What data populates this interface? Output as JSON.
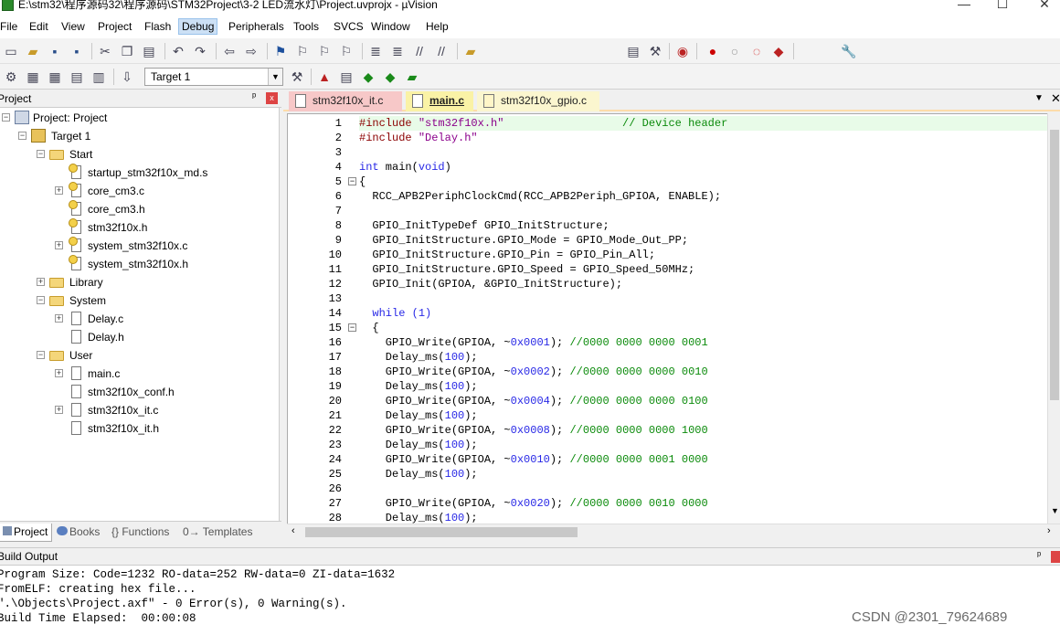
{
  "window": {
    "title": "E:\\stm32\\程序源码32\\程序源码\\STM32Project\\3-2 LED流水灯\\Project.uvprojx - µVision",
    "minimize": "—",
    "maximize": "☐",
    "close": "✕"
  },
  "menu": [
    "File",
    "Edit",
    "View",
    "Project",
    "Flash",
    "Debug",
    "Peripherals",
    "Tools",
    "SVCS",
    "Window",
    "Help"
  ],
  "toolbar": {
    "target_select": "Target 1"
  },
  "project_panel": {
    "title": "Project",
    "pin": "ᵖ",
    "close": "x",
    "tree": {
      "project": "Project: Project",
      "target": "Target 1",
      "groups": [
        {
          "name": "Start",
          "files": [
            "startup_stm32f10x_md.s",
            "core_cm3.c",
            "core_cm3.h",
            "stm32f10x.h",
            "system_stm32f10x.c",
            "system_stm32f10x.h"
          ]
        },
        {
          "name": "Library",
          "files": []
        },
        {
          "name": "System",
          "files": [
            "Delay.c",
            "Delay.h"
          ]
        },
        {
          "name": "User",
          "files": [
            "main.c",
            "stm32f10x_conf.h",
            "stm32f10x_it.c",
            "stm32f10x_it.h"
          ]
        }
      ]
    },
    "tabs": [
      "Project",
      "Books",
      "{} Functions",
      "0→ Templates"
    ]
  },
  "editor": {
    "tabs": [
      "stm32f10x_it.c",
      "main.c",
      "stm32f10x_gpio.c"
    ],
    "active_tab": "main.c",
    "highlighted_line": 1,
    "lines": [
      {
        "n": "1",
        "fold": ""
      },
      {
        "n": "2",
        "fold": ""
      },
      {
        "n": "3",
        "fold": ""
      },
      {
        "n": "4",
        "fold": ""
      },
      {
        "n": "5",
        "fold": "−"
      },
      {
        "n": "6",
        "fold": ""
      },
      {
        "n": "7",
        "fold": ""
      },
      {
        "n": "8",
        "fold": ""
      },
      {
        "n": "9",
        "fold": ""
      },
      {
        "n": "10",
        "fold": ""
      },
      {
        "n": "11",
        "fold": ""
      },
      {
        "n": "12",
        "fold": ""
      },
      {
        "n": "13",
        "fold": ""
      },
      {
        "n": "14",
        "fold": ""
      },
      {
        "n": "15",
        "fold": "−"
      },
      {
        "n": "16",
        "fold": ""
      },
      {
        "n": "17",
        "fold": ""
      },
      {
        "n": "18",
        "fold": ""
      },
      {
        "n": "19",
        "fold": ""
      },
      {
        "n": "20",
        "fold": ""
      },
      {
        "n": "21",
        "fold": ""
      },
      {
        "n": "22",
        "fold": ""
      },
      {
        "n": "23",
        "fold": ""
      },
      {
        "n": "24",
        "fold": ""
      },
      {
        "n": "25",
        "fold": ""
      },
      {
        "n": "26",
        "fold": ""
      },
      {
        "n": "27",
        "fold": ""
      },
      {
        "n": "28",
        "fold": ""
      }
    ],
    "code": [
      [
        {
          "t": "#include ",
          "c": "pp"
        },
        {
          "t": "\"stm32f10x.h\"",
          "c": "s"
        },
        {
          "t": "                  // Device header",
          "c": "c"
        }
      ],
      [
        {
          "t": "#include ",
          "c": "pp"
        },
        {
          "t": "\"Delay.h\"",
          "c": "s"
        }
      ],
      [],
      [
        {
          "t": "int",
          "c": "k"
        },
        {
          "t": " main(",
          "c": ""
        },
        {
          "t": "void",
          "c": "k"
        },
        {
          "t": ")",
          "c": ""
        }
      ],
      [
        {
          "t": "{",
          "c": ""
        }
      ],
      [
        {
          "t": "  RCC_APB2PeriphClockCmd(RCC_APB2Periph_GPIOA, ENABLE);",
          "c": ""
        }
      ],
      [],
      [
        {
          "t": "  GPIO_InitTypeDef GPIO_InitStructure;",
          "c": ""
        }
      ],
      [
        {
          "t": "  GPIO_InitStructure.GPIO_Mode = GPIO_Mode_Out_PP;",
          "c": ""
        }
      ],
      [
        {
          "t": "  GPIO_InitStructure.GPIO_Pin = GPIO_Pin_All;",
          "c": ""
        }
      ],
      [
        {
          "t": "  GPIO_InitStructure.GPIO_Speed = GPIO_Speed_50MHz;",
          "c": ""
        }
      ],
      [
        {
          "t": "  GPIO_Init(GPIOA, &GPIO_InitStructure);",
          "c": ""
        }
      ],
      [],
      [
        {
          "t": "  ",
          "c": ""
        },
        {
          "t": "while",
          "c": "k"
        },
        {
          "t": " (1)",
          "c": "n"
        }
      ],
      [
        {
          "t": "  {",
          "c": ""
        }
      ],
      [
        {
          "t": "    GPIO_Write(GPIOA, ~",
          "c": ""
        },
        {
          "t": "0x0001",
          "c": "n"
        },
        {
          "t": "); ",
          "c": ""
        },
        {
          "t": "//0000 0000 0000 0001",
          "c": "c"
        }
      ],
      [
        {
          "t": "    Delay_ms(",
          "c": ""
        },
        {
          "t": "100",
          "c": "n"
        },
        {
          "t": ");",
          "c": ""
        }
      ],
      [
        {
          "t": "    GPIO_Write(GPIOA, ~",
          "c": ""
        },
        {
          "t": "0x0002",
          "c": "n"
        },
        {
          "t": "); ",
          "c": ""
        },
        {
          "t": "//0000 0000 0000 0010",
          "c": "c"
        }
      ],
      [
        {
          "t": "    Delay_ms(",
          "c": ""
        },
        {
          "t": "100",
          "c": "n"
        },
        {
          "t": ");",
          "c": ""
        }
      ],
      [
        {
          "t": "    GPIO_Write(GPIOA, ~",
          "c": ""
        },
        {
          "t": "0x0004",
          "c": "n"
        },
        {
          "t": "); ",
          "c": ""
        },
        {
          "t": "//0000 0000 0000 0100",
          "c": "c"
        }
      ],
      [
        {
          "t": "    Delay_ms(",
          "c": ""
        },
        {
          "t": "100",
          "c": "n"
        },
        {
          "t": ");",
          "c": ""
        }
      ],
      [
        {
          "t": "    GPIO_Write(GPIOA, ~",
          "c": ""
        },
        {
          "t": "0x0008",
          "c": "n"
        },
        {
          "t": "); ",
          "c": ""
        },
        {
          "t": "//0000 0000 0000 1000",
          "c": "c"
        }
      ],
      [
        {
          "t": "    Delay_ms(",
          "c": ""
        },
        {
          "t": "100",
          "c": "n"
        },
        {
          "t": ");",
          "c": ""
        }
      ],
      [
        {
          "t": "    GPIO_Write(GPIOA, ~",
          "c": ""
        },
        {
          "t": "0x0010",
          "c": "n"
        },
        {
          "t": "); ",
          "c": ""
        },
        {
          "t": "//0000 0000 0001 0000",
          "c": "c"
        }
      ],
      [
        {
          "t": "    Delay_ms(",
          "c": ""
        },
        {
          "t": "100",
          "c": "n"
        },
        {
          "t": ");",
          "c": ""
        }
      ],
      [],
      [
        {
          "t": "    GPIO_Write(GPIOA, ~",
          "c": ""
        },
        {
          "t": "0x0020",
          "c": "n"
        },
        {
          "t": "); ",
          "c": ""
        },
        {
          "t": "//0000 0000 0010 0000",
          "c": "c"
        }
      ],
      [
        {
          "t": "    Delay_ms(",
          "c": ""
        },
        {
          "t": "100",
          "c": "n"
        },
        {
          "t": ");",
          "c": ""
        }
      ]
    ]
  },
  "build_output": {
    "title": "Build Output",
    "pin": "ᵖ",
    "lines": [
      "Program Size: Code=1232 RO-data=252 RW-data=0 ZI-data=1632",
      "FromELF: creating hex file...",
      "\".\\Objects\\Project.axf\" - 0 Error(s), 0 Warning(s).",
      "Build Time Elapsed:  00:00:08"
    ]
  },
  "watermark": "CSDN @2301_79624689"
}
